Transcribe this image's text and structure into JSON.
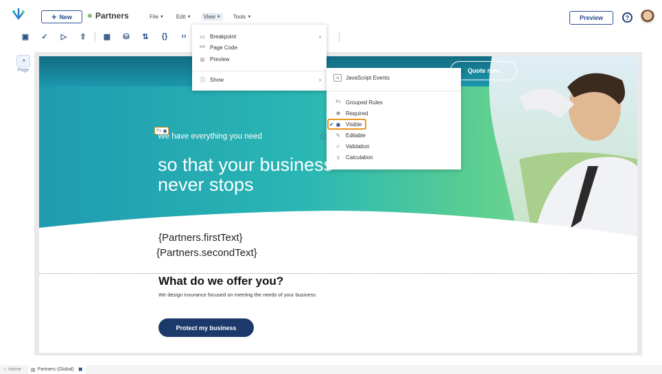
{
  "header": {
    "new_label": "New",
    "app_name": "Partners",
    "menus": [
      {
        "label": "File"
      },
      {
        "label": "Edit"
      },
      {
        "label": "View"
      },
      {
        "label": "Tools"
      }
    ],
    "preview_label": "Preview",
    "help_symbol": "?"
  },
  "left_panel": {
    "page_label": "Page"
  },
  "view_menu": {
    "items": [
      {
        "label": "Breakpoint",
        "icon": "monitor-icon",
        "glyph": "▭"
      },
      {
        "label": "Page Code",
        "icon": "code-icon",
        "glyph": "</>"
      },
      {
        "label": "Preview",
        "icon": "preview-icon",
        "glyph": "◎"
      },
      {
        "label": "Show",
        "icon": "info-icon",
        "glyph": "ⓘ"
      }
    ]
  },
  "show_menu": {
    "js_events": {
      "label": "JavaScript Events",
      "badge": "Js"
    },
    "items": [
      {
        "label": "Grouped Rules",
        "icon": "rules-icon",
        "glyph": "Rx"
      },
      {
        "label": "Required",
        "icon": "asterisk-icon",
        "glyph": "✱"
      },
      {
        "label": "Visible",
        "icon": "eye-icon",
        "glyph": "◉"
      },
      {
        "label": "Editable",
        "icon": "pencil-icon",
        "glyph": "✎"
      },
      {
        "label": "Validation",
        "icon": "check-icon",
        "glyph": "✓"
      },
      {
        "label": "Calculation",
        "icon": "calculator-icon",
        "glyph": "±"
      }
    ]
  },
  "canvas": {
    "quote_label": "Quote now",
    "rx_label": "Rx",
    "hero_subtitle": "We have everything you need",
    "hero_title_line1": "so that your business",
    "hero_title_line2": "never stops",
    "first_text": "{Partners.firstText}",
    "second_text": "{Partners.secondText}",
    "offer_title": "What do we offer you?",
    "offer_desc": "We design insurance focused on meeting the needs of your business",
    "protect_label": "Protect my business"
  },
  "bottom_tabs": {
    "home_label": "Home",
    "partners_label": "Partners (Global)"
  },
  "colors": {
    "brand": "#1f3f75",
    "accent_orange": "#e8941e",
    "hero_teal": "#2ab7b4",
    "hero_green": "#5ed08f"
  }
}
